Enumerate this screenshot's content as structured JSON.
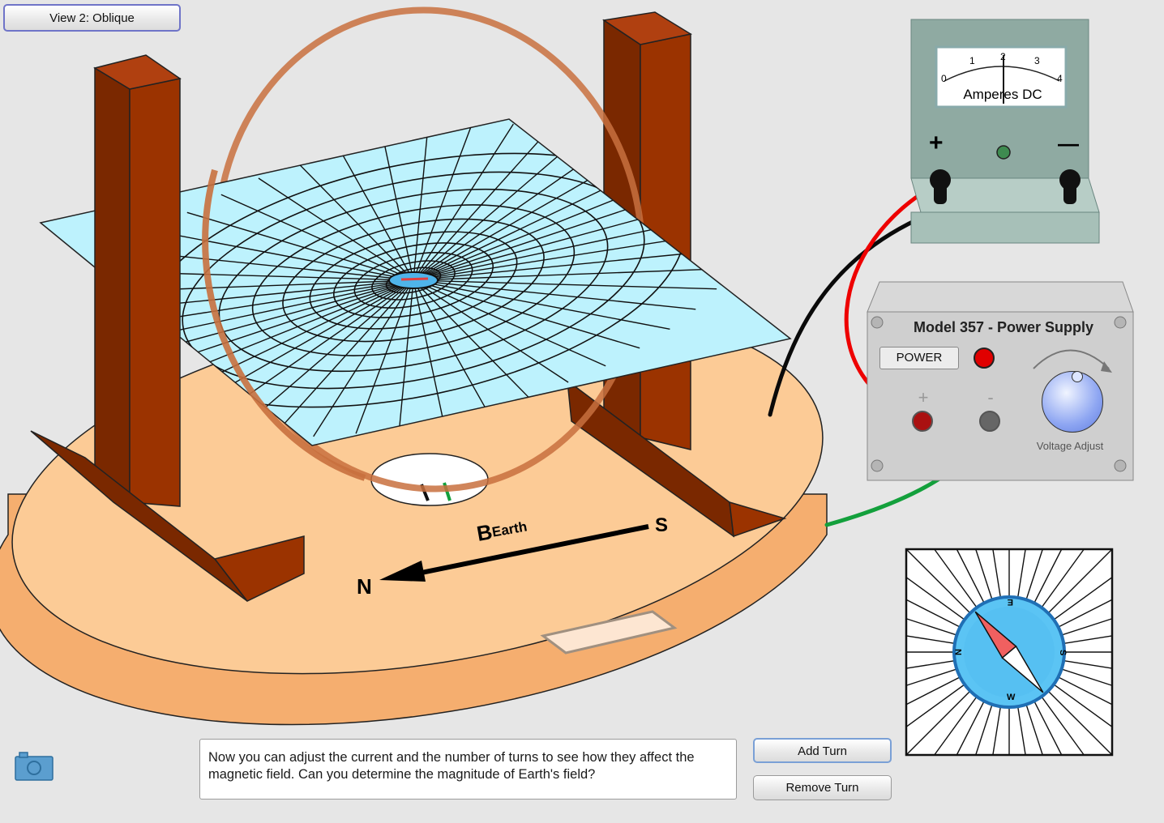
{
  "toolbar": {
    "view_button": "View 2: Oblique",
    "add_turn_button": "Add Turn",
    "remove_turn_button": "Remove Turn",
    "screenshot_icon": "camera-icon"
  },
  "instructions": {
    "text": "Now you can adjust the current and the number of turns to see how they affect the magnetic field.  Can you determine the magnitude of Earth's field?"
  },
  "ammeter": {
    "unit_label": "Amperes DC",
    "scale_ticks": [
      "0",
      "1",
      "2",
      "3",
      "4"
    ],
    "plus_symbol": "+",
    "minus_symbol": "—"
  },
  "power_supply": {
    "title": "Model 357 - Power Supply",
    "power_button": "POWER",
    "plus_symbol": "+",
    "minus_symbol": "-",
    "knob_label": "Voltage Adjust",
    "indicator_color": "#e00000"
  },
  "base": {
    "field_label_main": "B",
    "field_label_sub": "Earth",
    "north_label": "N",
    "south_label": "S"
  },
  "compass": {
    "labels": {
      "n": "N",
      "e": "E",
      "s": "S",
      "w": "W"
    },
    "needle_north_color": "#f06060"
  },
  "colors": {
    "wood": "#9b3300",
    "base_top": "#fccb96",
    "grid_sheet": "#bdf2fd",
    "coil": "#c8703e",
    "wire_red": "#ee0000",
    "wire_black": "#0a0a0a",
    "wire_green": "#13a03c"
  }
}
